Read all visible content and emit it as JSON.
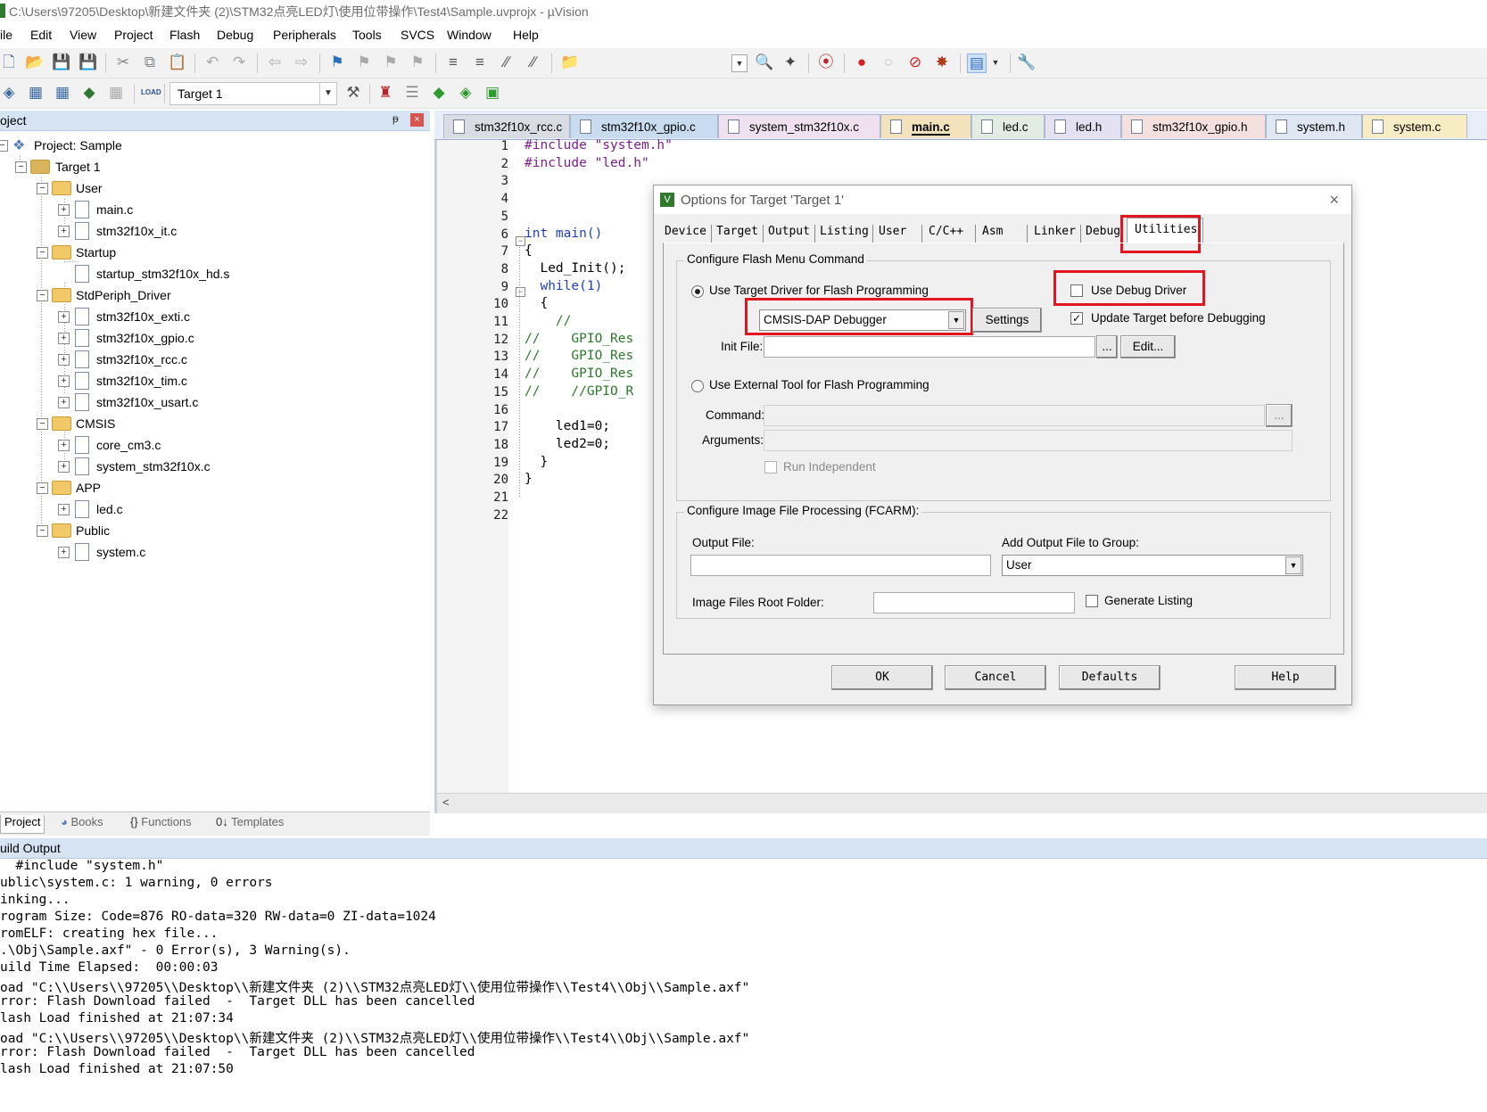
{
  "window": {
    "title": "C:\\Users\\97205\\Desktop\\新建文件夹 (2)\\STM32点亮LED灯\\使用位带操作\\Test4\\Sample.uvprojx - µVision"
  },
  "menu": [
    "ile",
    "Edit",
    "View",
    "Project",
    "Flash",
    "Debug",
    "Peripherals",
    "Tools",
    "SVCS",
    "Window",
    "Help"
  ],
  "toolbar2": {
    "load_label": "LOAD",
    "target_value": "Target 1"
  },
  "project_panel": {
    "title": "oject",
    "pin_glyph": "ᵽ",
    "close_glyph": "×",
    "tree": {
      "project": "Project: Sample",
      "target": "Target 1",
      "groups": [
        {
          "name": "User",
          "files": [
            "main.c",
            "stm32f10x_it.c"
          ]
        },
        {
          "name": "Startup",
          "files": [
            "startup_stm32f10x_hd.s"
          ]
        },
        {
          "name": "StdPeriph_Driver",
          "files": [
            "stm32f10x_exti.c",
            "stm32f10x_gpio.c",
            "stm32f10x_rcc.c",
            "stm32f10x_tim.c",
            "stm32f10x_usart.c"
          ]
        },
        {
          "name": "CMSIS",
          "files": [
            "core_cm3.c",
            "system_stm32f10x.c"
          ]
        },
        {
          "name": "APP",
          "files": [
            "led.c"
          ]
        },
        {
          "name": "Public",
          "files": [
            "system.c"
          ]
        }
      ]
    },
    "tabs": [
      "Project",
      "Books",
      "Functions",
      "Templates"
    ]
  },
  "editor": {
    "tabs": [
      "stm32f10x_rcc.c",
      "stm32f10x_gpio.c",
      "system_stm32f10x.c",
      "main.c",
      "led.c",
      "led.h",
      "stm32f10x_gpio.h",
      "system.h",
      "system.c"
    ],
    "active_tab": "main.c",
    "line_numbers": [
      "1",
      "2",
      "3",
      "4",
      "5",
      "6",
      "7",
      "8",
      "9",
      "10",
      "11",
      "12",
      "13",
      "14",
      "15",
      "16",
      "17",
      "18",
      "19",
      "20",
      "21",
      "22"
    ],
    "code_lines": [
      "#include \"system.h\"",
      "#include \"led.h\"",
      "",
      "",
      "",
      "int main()",
      "{",
      "  Led_Init();",
      "  while(1)",
      "  {",
      "    //",
      "//    GPIO_Res",
      "//    GPIO_Res",
      "//    GPIO_Res",
      "//    //GPIO_R",
      "",
      "    led1=0;",
      "    led2=0;",
      "  }",
      "}",
      "",
      ""
    ],
    "hscroll_glyph": "<"
  },
  "dialog": {
    "title": "Options for Target 'Target 1'",
    "icon_glyph": "V",
    "close_glyph": "×",
    "tabs": [
      "Device",
      "Target",
      "Output",
      "Listing",
      "User",
      "C/C++",
      "Asm",
      "Linker",
      "Debug",
      "Utilities"
    ],
    "active_tab": "Utilities",
    "flash_group": {
      "title": "Configure Flash Menu Command",
      "use_target_driver": "Use Target Driver for Flash Programming",
      "use_debug_driver": "Use Debug Driver",
      "driver_value": "CMSIS-DAP Debugger",
      "settings_button": "Settings",
      "update_target": "Update Target before Debugging",
      "init_file_label": "Init File:",
      "init_file_value": "",
      "browse_button": "...",
      "edit_button": "Edit...",
      "use_external_tool": "Use External Tool for Flash Programming",
      "command_label": "Command:",
      "arguments_label": "Arguments:",
      "cmd_browse": "...",
      "run_independent": "Run Independent"
    },
    "image_group": {
      "title": "Configure Image File Processing (FCARM):",
      "output_file_label": "Output File:",
      "add_output_label": "Add Output File  to Group:",
      "group_value": "User",
      "root_folder_label": "Image Files Root Folder:",
      "generate_listing": "Generate Listing"
    },
    "buttons": {
      "ok": "OK",
      "cancel": "Cancel",
      "defaults": "Defaults",
      "help": "Help"
    }
  },
  "build_output": {
    "title": "uild Output",
    "lines": [
      "  #include \"system.h\"",
      "ublic\\system.c: 1 warning, 0 errors",
      "inking...",
      "rogram Size: Code=876 RO-data=320 RW-data=0 ZI-data=1024",
      "romELF: creating hex file...",
      ".\\Obj\\Sample.axf\" - 0 Error(s), 3 Warning(s).",
      "uild Time Elapsed:  00:00:03",
      "oad \"C:\\\\Users\\\\97205\\\\Desktop\\\\新建文件夹 (2)\\\\STM32点亮LED灯\\\\使用位带操作\\\\Test4\\\\Obj\\\\Sample.axf\"",
      "rror: Flash Download failed  -  Target DLL has been cancelled",
      "lash Load finished at 21:07:34",
      "oad \"C:\\\\Users\\\\97205\\\\Desktop\\\\新建文件夹 (2)\\\\STM32点亮LED灯\\\\使用位带操作\\\\Test4\\\\Obj\\\\Sample.axf\"",
      "rror: Flash Download failed  -  Target DLL has been cancelled",
      "lash Load finished at 21:07:50"
    ]
  },
  "colors": {
    "highlight_red": "#e2141d",
    "panel_header": "#d6e3f3",
    "keyword_blue": "#1f3fbf",
    "comment_green": "#2a7a2a",
    "string_purple": "#7a1f8a"
  },
  "icons": [
    "new-file-icon",
    "open-icon",
    "save-icon",
    "save-all-icon",
    "cut-icon",
    "copy-icon",
    "paste-icon",
    "undo-icon",
    "redo-icon",
    "back-icon",
    "forward-icon",
    "bookmark-icon",
    "find-icon",
    "debug-start-icon",
    "breakpoint-icon",
    "settings-wrench-icon",
    "build-icon",
    "rebuild-icon",
    "download-icon",
    "manage-icon"
  ]
}
